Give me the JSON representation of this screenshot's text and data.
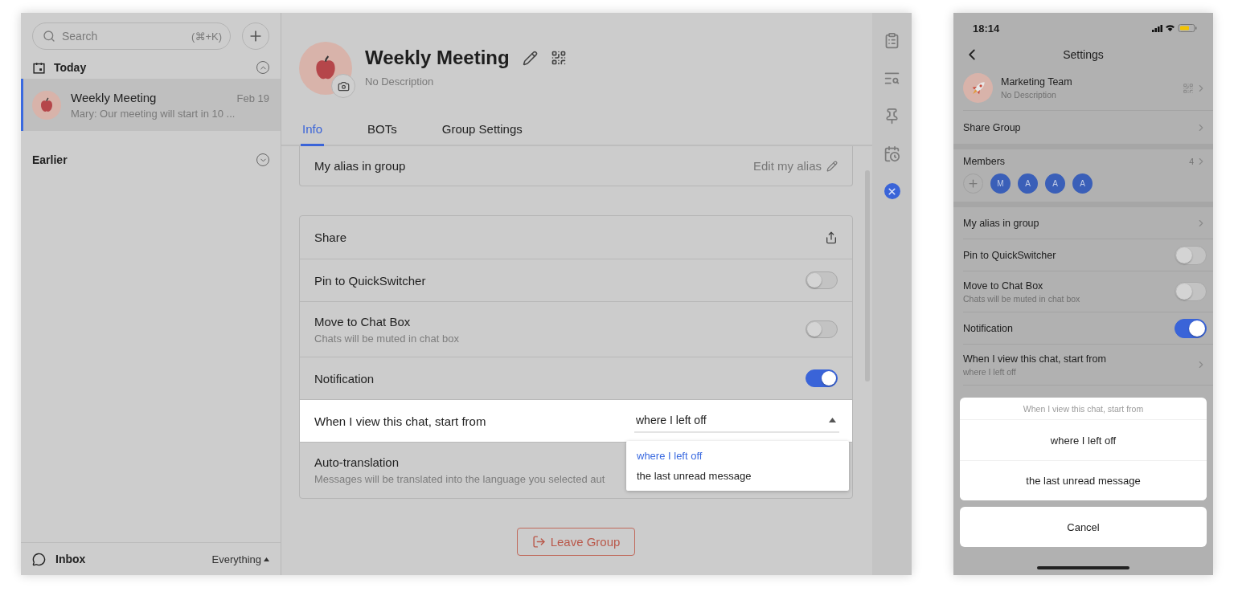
{
  "sidebar": {
    "search": {
      "placeholder": "Search",
      "shortcut": "(⌘+K)"
    },
    "sections": [
      {
        "title": "Today",
        "expanded": true,
        "chats": [
          {
            "name": "Weekly Meeting",
            "time": "Feb 19",
            "preview": "Mary: Our meeting will start in 10 ...",
            "selected": true
          }
        ]
      },
      {
        "title": "Earlier",
        "expanded": false
      }
    ],
    "footer": {
      "label": "Inbox",
      "filter": "Everything"
    }
  },
  "group": {
    "name": "Weekly Meeting",
    "description": "No Description"
  },
  "tabs": [
    {
      "label": "Info",
      "selected": true
    },
    {
      "label": "BOTs",
      "selected": false
    },
    {
      "label": "Group Settings",
      "selected": false
    }
  ],
  "alias_row": {
    "label": "My alias in group",
    "action": "Edit my alias"
  },
  "settings": [
    {
      "kind": "link",
      "label": "Share"
    },
    {
      "kind": "toggle",
      "label": "Pin to QuickSwitcher",
      "on": false
    },
    {
      "kind": "toggle",
      "label": "Move to Chat Box",
      "description": "Chats will be muted in chat box",
      "on": false
    },
    {
      "kind": "toggle",
      "label": "Notification",
      "on": true
    },
    {
      "kind": "select",
      "label": "When I view this chat, start from",
      "value": "where I left off",
      "options": [
        {
          "label": "where I left off",
          "selected": true
        },
        {
          "label": "the last unread message",
          "selected": false
        }
      ]
    },
    {
      "kind": "info",
      "label": "Auto-translation",
      "description": "Messages will be translated into the language you selected aut"
    }
  ],
  "leave_button": "Leave Group",
  "phone": {
    "time": "18:14",
    "title": "Settings",
    "group": {
      "name": "Marketing Team",
      "description": "No Description"
    },
    "share": "Share Group",
    "members": {
      "label": "Members",
      "count": "4",
      "avatars": [
        "M",
        "A",
        "A",
        "A"
      ]
    },
    "rows": [
      {
        "kind": "link",
        "label": "My alias in group"
      },
      {
        "kind": "toggle",
        "label": "Pin to QuickSwitcher",
        "on": false
      },
      {
        "kind": "toggle",
        "label": "Move to Chat Box",
        "description": "Chats will be muted in chat box",
        "on": false
      },
      {
        "kind": "toggle",
        "label": "Notification",
        "on": true
      },
      {
        "kind": "link",
        "label": "When I view this chat, start from",
        "description": "where I left off"
      }
    ],
    "sheet": {
      "title": "When I view this chat, start from",
      "options": [
        "where I left off",
        "the last unread message"
      ],
      "cancel": "Cancel"
    }
  }
}
